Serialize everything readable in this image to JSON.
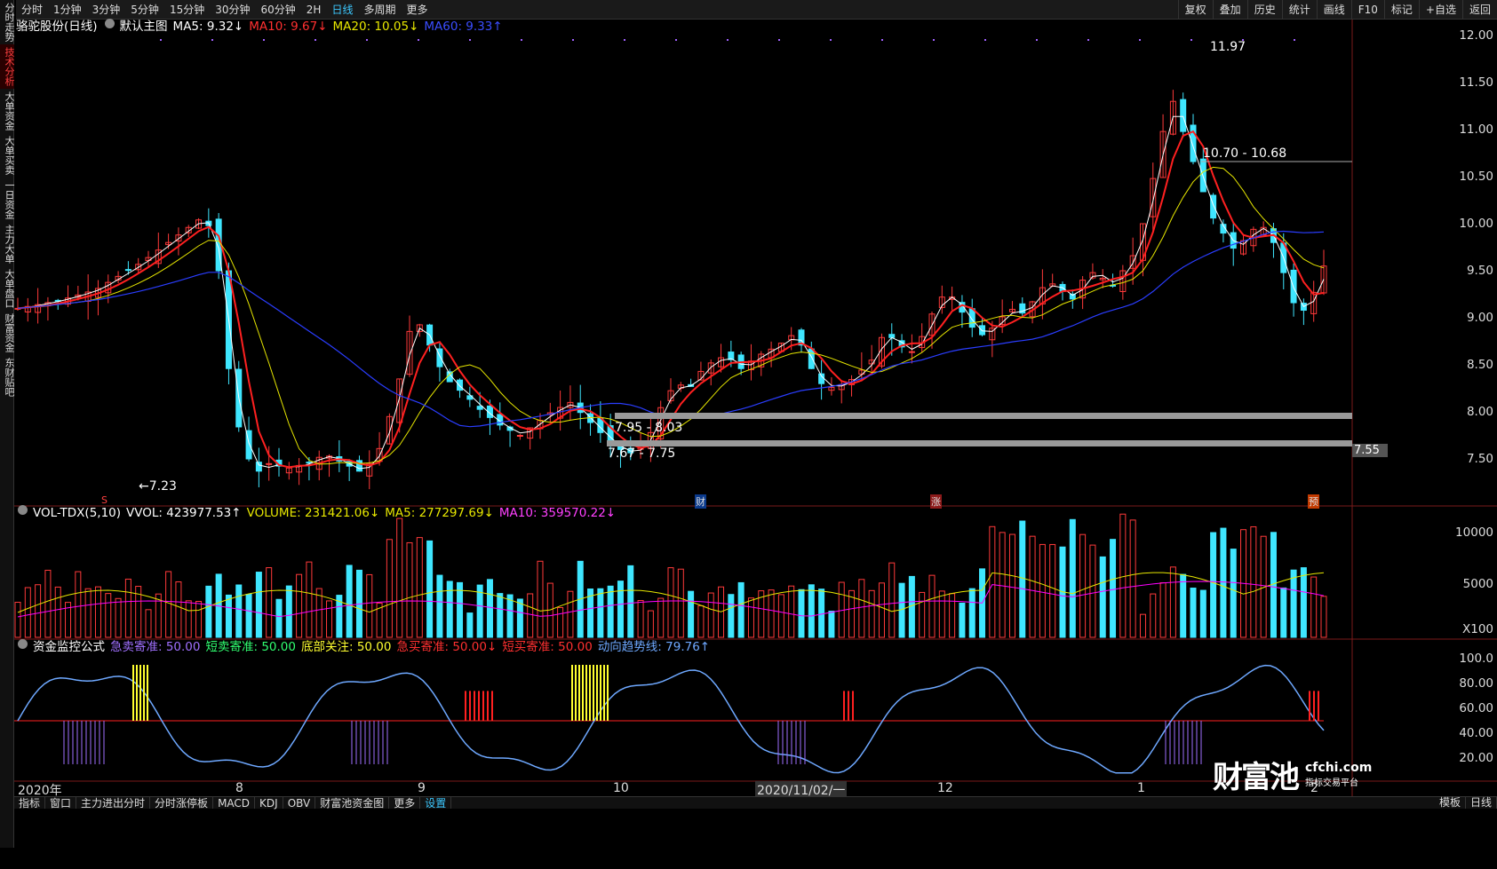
{
  "topbar": {
    "periods": [
      "分时",
      "1分钟",
      "3分钟",
      "5分钟",
      "15分钟",
      "30分钟",
      "60分钟",
      "2H",
      "日线",
      "多周期",
      "更多"
    ],
    "active_period": "日线",
    "right_buttons": [
      "复权",
      "叠加",
      "历史",
      "统计",
      "画线",
      "F10",
      "标记",
      "+自选",
      "返回"
    ]
  },
  "sidebar": {
    "items": [
      "分时走势",
      "技术分析",
      "大单资金",
      "大单买卖",
      "一日资金",
      "主力大单",
      "大单盘口",
      "财富资金",
      "东财贴吧"
    ],
    "active": "技术分析"
  },
  "main_info": {
    "stock": "骆驼股份(日线)",
    "template": "默认主图",
    "ma5": "MA5: 9.32↓",
    "ma10": "MA10: 9.67↓",
    "ma20": "MA20: 10.05↓",
    "ma60": "MA60: 9.33↑"
  },
  "vol_info": {
    "name": "VOL-TDX(5,10)",
    "vvol": "VVOL: 423977.53↑",
    "volume": "VOLUME: 231421.06↓",
    "ma5": "MA5: 277297.69↓",
    "ma10": "MA10: 359570.22↓"
  },
  "ind_info": {
    "name": "资金监控公式",
    "a": "急卖寄准: 50.00",
    "b": "短卖寄准: 50.00",
    "c": "底部关注: 50.00",
    "d": "急买寄准: 50.00↓",
    "e": "短买寄准: 50.00",
    "f": "动向趋势线: 79.76↑"
  },
  "price_axis": [
    "12.00",
    "11.50",
    "11.00",
    "10.50",
    "10.00",
    "9.50",
    "9.00",
    "8.50",
    "8.00",
    "7.50"
  ],
  "current_price_tag": "7.55",
  "vol_axis": [
    "10000",
    "5000",
    "X100"
  ],
  "ind_axis": [
    "100.0",
    "80.00",
    "60.00",
    "40.00",
    "20.00"
  ],
  "x_axis": {
    "labels": [
      "2020年",
      "8",
      "9",
      "10",
      "2020/11/02/一",
      "12",
      "1",
      "2"
    ]
  },
  "annotations": {
    "low_label": "←7.23",
    "high_label": "11.97",
    "zone1": "10.70 - 10.68",
    "zone2": "7.95 - 8.03",
    "zone3": "7.67 - 7.75",
    "marker_s": "S",
    "marker_cai": "财",
    "marker_zhang": "涨",
    "marker_yu": "预"
  },
  "bottombar": {
    "tabs": [
      "指标",
      "窗口",
      "主力进出分时",
      "分时涨停板",
      "MACD",
      "KDJ",
      "OBV",
      "财富池资金图",
      "更多",
      "设置"
    ],
    "active": "设置",
    "right": [
      "模板",
      "日线"
    ]
  },
  "watermark": {
    "logo": "财富池",
    "url": "cfchi.com",
    "sub": "指标交易平台"
  },
  "colors": {
    "up": "#ff3a3a",
    "down": "#3fe6ff",
    "ma5": "#ffffff",
    "ma10": "#ff2020",
    "ma20": "#e6e600",
    "ma60": "#2a3dff",
    "vol_ma10": "#ff00ff",
    "trend": "#6ea8ff"
  }
}
